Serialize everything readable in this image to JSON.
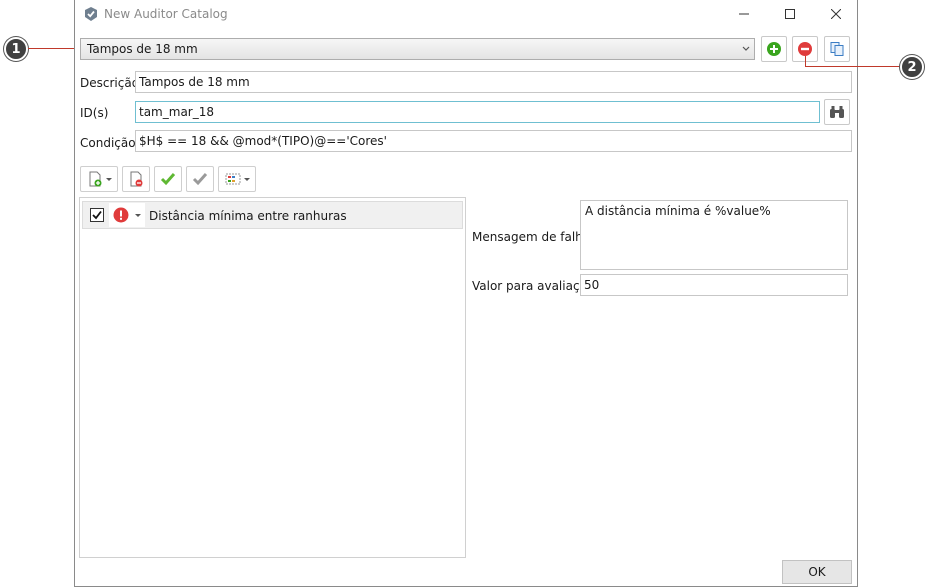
{
  "window": {
    "title": "New Auditor Catalog"
  },
  "catalog": {
    "selected": "Tampos de 18 mm"
  },
  "form": {
    "descricao_label": "Descrição",
    "descricao_value": "Tampos de 18 mm",
    "ids_label": "ID(s)",
    "ids_value": "tam_mar_18",
    "condicao_label": "Condição",
    "condicao_value": "$H$ == 18 && @mod*(TIPO)@=='Cores'"
  },
  "rules": [
    {
      "checked": true,
      "severity_icon": "error-icon",
      "label": "Distância mínima entre ranhuras"
    }
  ],
  "detail": {
    "mensagem_label": "Mensagem de falha",
    "mensagem_value": "A distância mínima é %value%",
    "valor_label": "Valor para avaliação",
    "valor_value": "50"
  },
  "ok_label": "OK",
  "callouts": {
    "one": "1",
    "two": "2"
  },
  "colors": {
    "callout_line": "#c0392b",
    "add_green": "#3aa51e",
    "remove_red": "#e03b3b",
    "focus_border": "#6fbfd1"
  }
}
